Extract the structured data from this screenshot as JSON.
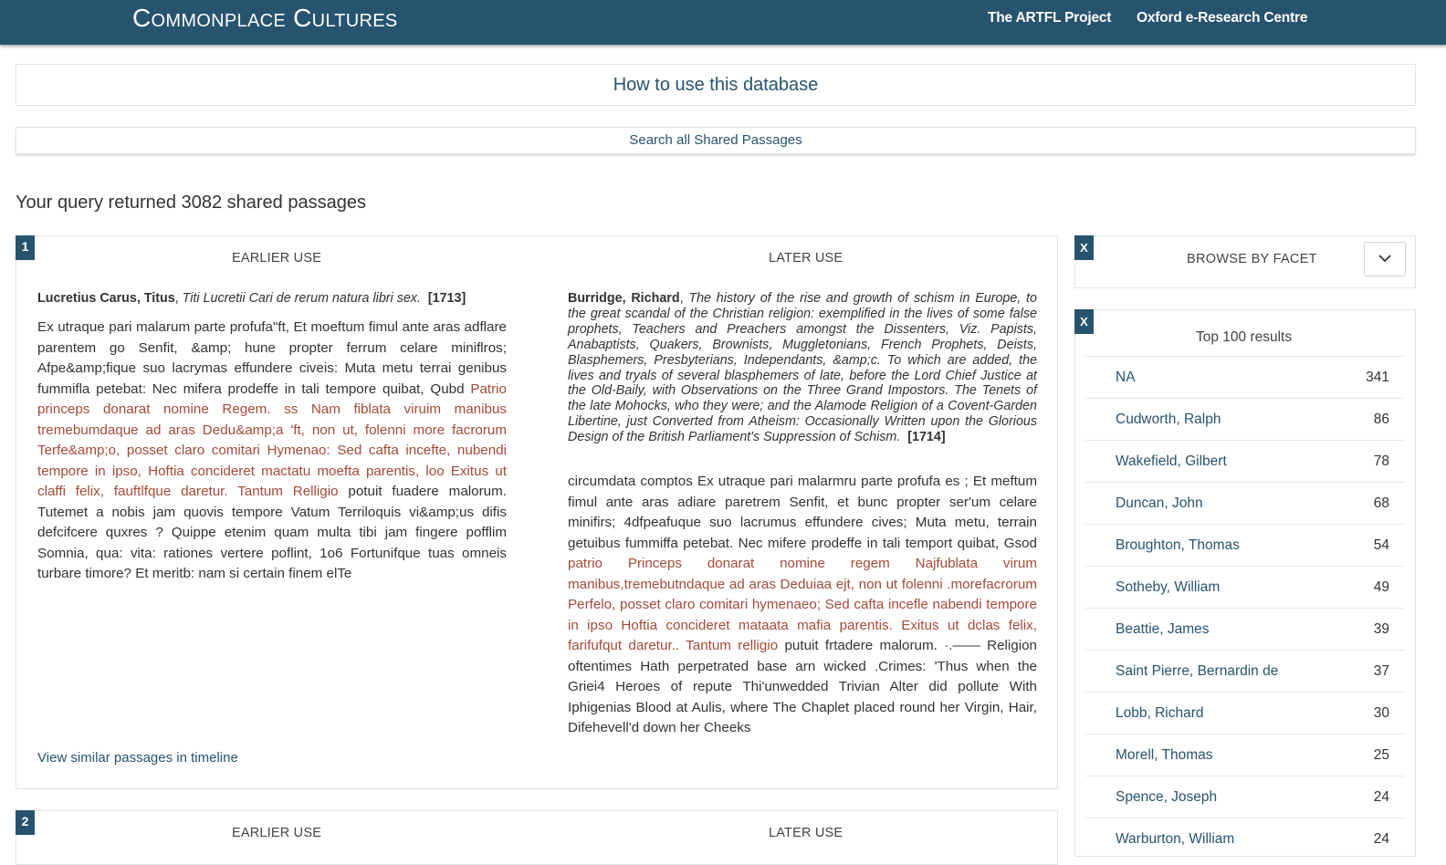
{
  "navbar": {
    "brand": "Commonplace Cultures",
    "links": [
      "The ARTFL Project",
      "Oxford e-Research Centre"
    ]
  },
  "banners": {
    "how_to": "How to use this database",
    "search_all": "Search all Shared Passages"
  },
  "query_summary": "Your query returned 3082 shared passages",
  "results": [
    {
      "number": "1",
      "earlier_label": "EARLIER USE",
      "later_label": "LATER USE",
      "earlier": {
        "author": "Lucretius Carus, Titus",
        "title": "Titi Lucretii Cari de rerum natura libri sex.",
        "date": "[1713]",
        "passage_pre": "Ex utraque pari malarum parte profufa\"ft, Et moeftum fimul ante aras adflare parentem go Senfit, &amp; hune propter ferrum celare miniflros; Afpe&amp;fique suo lacrymas effundere civeis: Muta metu terrai genibus fummifla petebat: Nec mifera prodeffe in tali tempore quibat, Qubd ",
        "passage_match": "Patrio princeps donarat nomine Regem. ss Nam fiblata viruim manibus tremebumdaque ad aras Dedu&amp;a 'ft, non ut, folenni more facrorum Terfe&amp;o, posset claro comitari Hymenao: Sed cafta incefte, nubendi tempore in ipso, Hoftia concideret mactatu moefta parentis, loo Exitus ut claffi felix, fauftlfque daretur. Tantum Relligio",
        "passage_post": " potuit fuadere malorum. Tutemet a nobis jam quovis tempore Vatum Terriloquis vi&amp;us difis defcifcere quxres ? Quippe etenim quam multa tibi jam fingere pofflim Somnia, qua: vita: rationes vertere poflint, 1o6 Fortunifque tuas omneis turbare timore? Et meritb: nam si certain finem elTe"
      },
      "later": {
        "author": "Burridge, Richard",
        "title": "The history of the rise and growth of schism in Europe, to the great scandal of the Christian religion: exemplified in the lives of some false prophets, Teachers and Preachers amongst the Dissenters, Viz. Papists, Anabaptists, Quakers, Brownists, Muggletonians, French Prophets, Deists, Blasphemers, Presbyterians, Independants, &amp;c. To which are added, the lives and tryals of several blasphemers of late, before the Lord Chief Justice at the Old-Baily, with Observations on the Three Grand Impostors. The Tenets of the late Mohocks, who they were; and the Alamode Religion of a Covent-Garden Libertine, just Converted from Atheism: Occasionally Written upon the Glorious Design of the British Parliament's Suppression of Schism.",
        "date": "[1714]",
        "passage_pre": "circumdata comptos Ex utraque pari malarmru parte profufa es ; Et meftum fimul ante aras adiare paretrem Senfit, et bunc propter ser'um celare minifirs; 4dfpeafuque suo lacrumus effundere cives; Muta metu, terrain getuibus fummiffa petebat. Nec mifere prodeffe in tali temport quibat, Gsod ",
        "passage_match": "patrio Princeps donarat nomine regem Najfublata virum manibus,tremebutndaque ad aras Deduiaa ejt, non ut folenni .morefacrorum Perfelo, posset claro comitari hymenaeo; Sed cafta incefle nabendi tempore in ipso Hoftia concideret mataata mafia parentis. Exitus ut dclas felix, farifufqut daretur.. Tantum relligio",
        "passage_post": " putuit frtadere malorum. ·.—— Religion oftentimes Hath perpetrated base arn wicked .Crimes: 'Thus when the Griei4 Heroes of repute Thi'unwedded Trivian Alter did pollute With Iphigenias Blood at Aulis, where The Chaplet placed round her Virgin, Hair, Difehevell'd down her Cheeks"
      },
      "timeline_link": "View similar passages in timeline"
    },
    {
      "number": "2",
      "earlier_label": "EARLIER USE",
      "later_label": "LATER USE"
    }
  ],
  "facets": {
    "browse_label": "BROWSE BY FACET",
    "close_label": "X",
    "results_title": "Top 100 results",
    "items": [
      {
        "name": "NA",
        "count": "341"
      },
      {
        "name": "Cudworth, Ralph",
        "count": "86"
      },
      {
        "name": "Wakefield, Gilbert",
        "count": "78"
      },
      {
        "name": "Duncan, John",
        "count": "68"
      },
      {
        "name": "Broughton, Thomas",
        "count": "54"
      },
      {
        "name": "Sotheby, William",
        "count": "49"
      },
      {
        "name": "Beattie, James",
        "count": "39"
      },
      {
        "name": "Saint Pierre, Bernardin de",
        "count": "37"
      },
      {
        "name": "Lobb, Richard",
        "count": "30"
      },
      {
        "name": "Morell, Thomas",
        "count": "25"
      },
      {
        "name": "Spence, Joseph",
        "count": "24"
      },
      {
        "name": "Warburton, William",
        "count": "24"
      }
    ]
  },
  "colors": {
    "navbar": "#27536e",
    "link": "#27536e",
    "highlight": "#a34a38"
  }
}
